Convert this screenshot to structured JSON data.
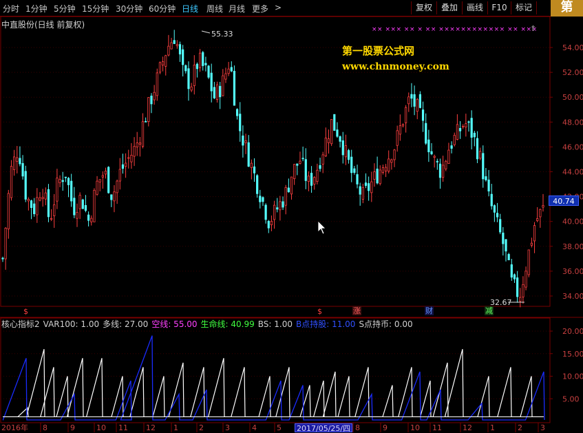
{
  "toolbar": {
    "periods": [
      "分时",
      "1分钟",
      "5分钟",
      "15分钟",
      "30分钟",
      "60分钟",
      "日线",
      "周线",
      "月线",
      "更多"
    ],
    "more_chevron": ">",
    "buttons": [
      "复权",
      "叠加",
      "画线",
      "F10",
      "标记"
    ],
    "corner_logo": "第"
  },
  "main_chart": {
    "title": "中直股份(日线 前复权)",
    "watermark_title": "第一股票公式网",
    "watermark_url": "www.chnmoney.com",
    "price_axis": [
      "54.00",
      "52.00",
      "50.00",
      "48.00",
      "46.00",
      "44.00",
      "42.00",
      "40.00",
      "38.00",
      "36.00",
      "34.00"
    ],
    "high_label": "55.33",
    "low_label": "32.67",
    "current_price": "40.74",
    "event_markers": [
      "$",
      "$",
      "涨",
      "财",
      "减"
    ],
    "top_symbols": "×× ××× ×× × ×× ×××××××××××× ×× ×××"
  },
  "indicator": {
    "name": "核心指标2",
    "var100": "VAR100: 1.00",
    "duoxian": "多线: 27.00",
    "kongxian": "空线: 55.00",
    "shengmingxian": "生命线: 40.99",
    "bs": "BS: 1.00",
    "b_hold": "B点持股: 11.00",
    "s_hold": "S点持币: 0.00",
    "axis": [
      "20.00",
      "15.00",
      "10.00",
      "5.00"
    ]
  },
  "time_axis": {
    "labels": [
      "2016年",
      "8",
      "9",
      "10",
      "11",
      "12",
      "1",
      "2",
      "3",
      "4",
      "5",
      "8",
      "9",
      "10",
      "11",
      "12",
      "1",
      "2",
      "3"
    ],
    "cursor_date": "2017/05/25/四"
  },
  "colors": {
    "grid": "#7a0000",
    "up": "#ff4040",
    "down": "#54ffff",
    "white_line": "#ffffff",
    "blue_line": "#1a2cff",
    "kongxian": "#ff40ff",
    "shengmingxian": "#40ff40",
    "b_hold": "#3050ff",
    "price_tag_bg": "#1030b0",
    "watermark": "#ffd800"
  },
  "chart_data": {
    "type": "candlestick",
    "ylim": [
      32.67,
      55.33
    ],
    "close_path": [
      37,
      44,
      46,
      42,
      41,
      43,
      40,
      43,
      44,
      41,
      42,
      40,
      43,
      44,
      42,
      44,
      45,
      46,
      48,
      50,
      52,
      54,
      55,
      52,
      51,
      53,
      52,
      50,
      51,
      53,
      48,
      46,
      44,
      42,
      40,
      41,
      42,
      44,
      45,
      43,
      44,
      46,
      48,
      47,
      45,
      43,
      42,
      43,
      44,
      45,
      46,
      48,
      50,
      49,
      47,
      45,
      44,
      46,
      47,
      48,
      47,
      45,
      42,
      40,
      38,
      35,
      34,
      37,
      40,
      41
    ]
  }
}
